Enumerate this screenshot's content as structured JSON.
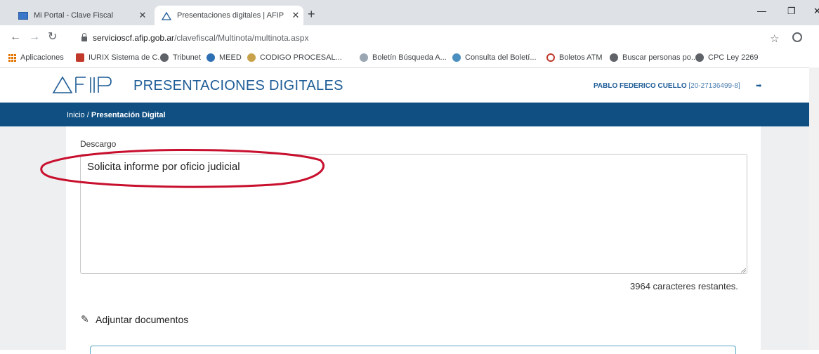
{
  "browser": {
    "tabs": [
      {
        "title": "Mi Portal - Clave Fiscal",
        "active": false
      },
      {
        "title": "Presentaciones digitales | AFIP",
        "active": true
      }
    ],
    "new_tab_label": "+",
    "url_host": "servicioscf.afip.gob.ar",
    "url_path": "/clavefiscal/Multinota/multinota.aspx",
    "bookmarks": [
      {
        "label": "Aplicaciones",
        "icon": "apps-icon"
      },
      {
        "label": "IURIX Sistema de C...",
        "icon": "pj-icon"
      },
      {
        "label": "Tribunet",
        "icon": "globe-icon"
      },
      {
        "label": "MEED",
        "icon": "meed-icon"
      },
      {
        "label": "CODIGO PROCESAL...",
        "icon": "bookmark-icon"
      },
      {
        "label": "Boletín Búsqueda A...",
        "icon": "bookmark-icon"
      },
      {
        "label": "Consulta del Boletí...",
        "icon": "bookmark-icon"
      },
      {
        "label": "Boletos ATM",
        "icon": "atm-icon"
      },
      {
        "label": "Buscar personas po...",
        "icon": "globe-icon"
      },
      {
        "label": "CPC Ley 2269",
        "icon": "globe-icon"
      }
    ]
  },
  "header": {
    "logo_text": "AFIP",
    "title": "PRESENTACIONES DIGITALES",
    "user_name": "PABLO FEDERICO CUELLO",
    "user_cuit": "[20-27136499-8]"
  },
  "breadcrumb": {
    "home": "Inicio /",
    "current": "Presentación Digital"
  },
  "form": {
    "description_label": "Descargo",
    "description_value": "Solicita informe por oficio judicial",
    "remaining_chars": "3964 caracteres restantes.",
    "attach_title": "Adjuntar documentos"
  },
  "colors": {
    "brand_blue": "#1e5c96",
    "bar_blue": "#0f4f82",
    "annotation_red": "#c8102e"
  }
}
